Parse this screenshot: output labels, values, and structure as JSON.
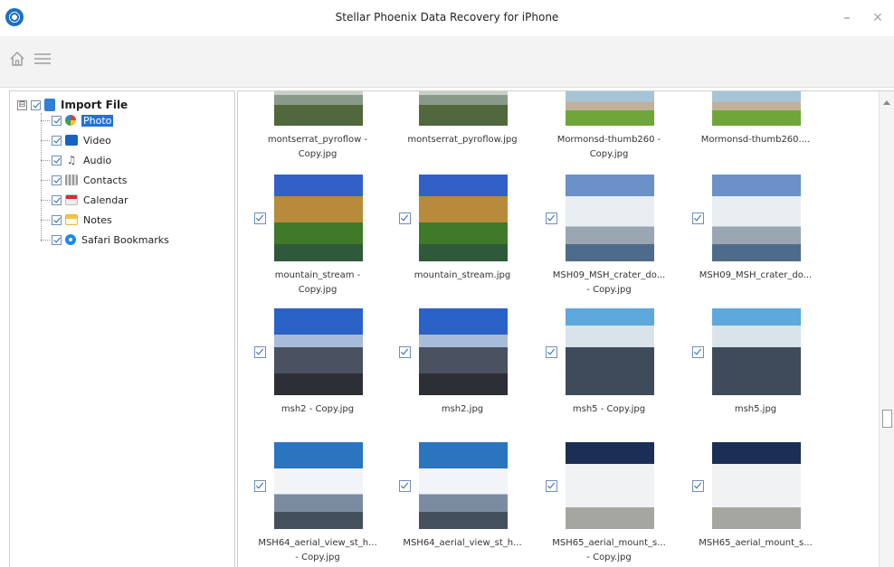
{
  "window": {
    "title": "Stellar Phoenix Data Recovery for iPhone",
    "minimize_glyph": "–",
    "close_glyph": "✕"
  },
  "toolbar": {
    "icons": [
      "home-icon",
      "menu-icon"
    ]
  },
  "tree": {
    "root": {
      "label": "Import File",
      "expander": "⊟",
      "checked": true
    },
    "items": [
      {
        "label": "Photo",
        "icon": "photo-icon",
        "checked": true,
        "selected": true
      },
      {
        "label": "Video",
        "icon": "video-icon",
        "checked": true,
        "selected": false
      },
      {
        "label": "Audio",
        "icon": "audio-icon",
        "icon_glyph": "♫",
        "checked": true,
        "selected": false
      },
      {
        "label": "Contacts",
        "icon": "contacts-icon",
        "checked": true,
        "selected": false
      },
      {
        "label": "Calendar",
        "icon": "calendar-icon",
        "checked": true,
        "selected": false
      },
      {
        "label": "Notes",
        "icon": "notes-icon",
        "checked": true,
        "selected": false
      },
      {
        "label": "Safari Bookmarks",
        "icon": "safari-icon",
        "checked": true,
        "selected": false
      }
    ]
  },
  "gallery": {
    "rows": [
      [
        {
          "caption_1": "montserrat_pyroflow -",
          "caption_2": "Copy.jpg",
          "checked": true
        },
        {
          "caption_1": "montserrat_pyroflow.jpg",
          "caption_2": "",
          "checked": true
        },
        {
          "caption_1": "Mormonsd-thumb260 -",
          "caption_2": "Copy.jpg",
          "checked": true
        },
        {
          "caption_1": "Mormonsd-thumb260....",
          "caption_2": "",
          "checked": true
        }
      ],
      [
        {
          "caption_1": "mountain_stream -",
          "caption_2": "Copy.jpg",
          "checked": true
        },
        {
          "caption_1": "mountain_stream.jpg",
          "caption_2": "",
          "checked": true
        },
        {
          "caption_1": "MSH09_MSH_crater_do...",
          "caption_2": "- Copy.jpg",
          "checked": true
        },
        {
          "caption_1": "MSH09_MSH_crater_do...",
          "caption_2": "",
          "checked": true
        }
      ],
      [
        {
          "caption_1": "msh2 - Copy.jpg",
          "caption_2": "",
          "checked": true
        },
        {
          "caption_1": "msh2.jpg",
          "caption_2": "",
          "checked": true
        },
        {
          "caption_1": "msh5 - Copy.jpg",
          "caption_2": "",
          "checked": true
        },
        {
          "caption_1": "msh5.jpg",
          "caption_2": "",
          "checked": true
        }
      ],
      [
        {
          "caption_1": "MSH64_aerial_view_st_h...",
          "caption_2": "- Copy.jpg",
          "checked": true
        },
        {
          "caption_1": "MSH64_aerial_view_st_h...",
          "caption_2": "",
          "checked": true
        },
        {
          "caption_1": "MSH65_aerial_mount_s...",
          "caption_2": "- Copy.jpg",
          "checked": true
        },
        {
          "caption_1": "MSH65_aerial_mount_s...",
          "caption_2": "",
          "checked": true
        }
      ]
    ]
  },
  "scroll": {
    "position_fraction": 0.68
  }
}
